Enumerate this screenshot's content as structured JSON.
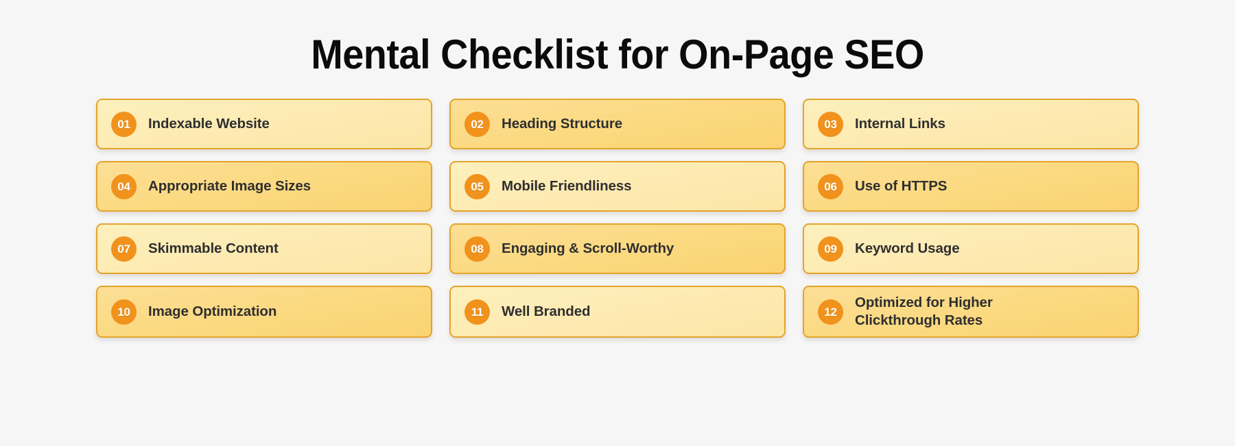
{
  "header": {
    "title": "Mental Checklist for On-Page SEO"
  },
  "theme": {
    "background": "#f6f6f6",
    "card_border": "#e3a32c",
    "card_light": "#fdeab1",
    "card_dark": "#fbd97f",
    "badge_bg": "#f1921c",
    "badge_text": "#ffffff",
    "label_text": "#2f2f2f",
    "title_text": "#0b0b0b"
  },
  "checklist": {
    "items": [
      {
        "number": "01",
        "label": "Indexable Website",
        "tone": "light"
      },
      {
        "number": "02",
        "label": "Heading Structure",
        "tone": "dark"
      },
      {
        "number": "03",
        "label": "Internal Links",
        "tone": "light"
      },
      {
        "number": "04",
        "label": "Appropriate Image Sizes",
        "tone": "dark"
      },
      {
        "number": "05",
        "label": "Mobile Friendliness",
        "tone": "light"
      },
      {
        "number": "06",
        "label": "Use of HTTPS",
        "tone": "dark"
      },
      {
        "number": "07",
        "label": "Skimmable Content",
        "tone": "light"
      },
      {
        "number": "08",
        "label": "Engaging & Scroll-Worthy",
        "tone": "dark"
      },
      {
        "number": "09",
        "label": "Keyword Usage",
        "tone": "light"
      },
      {
        "number": "10",
        "label": "Image Optimization",
        "tone": "dark"
      },
      {
        "number": "11",
        "label": "Well Branded",
        "tone": "light"
      },
      {
        "number": "12",
        "label": "Optimized for Higher Clickthrough Rates",
        "tone": "dark"
      }
    ]
  }
}
